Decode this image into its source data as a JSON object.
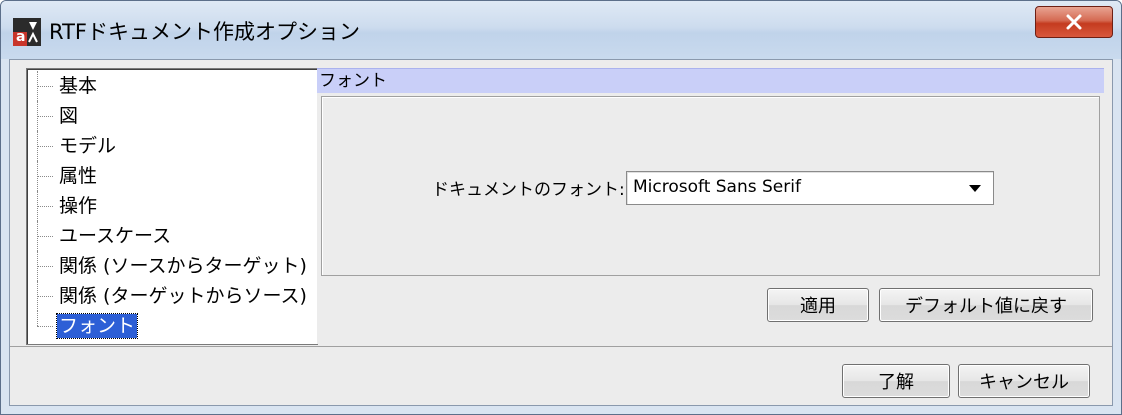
{
  "window": {
    "title": "RTFドキュメント作成オプション",
    "app_icon": "astah-icon",
    "close_icon": "close-icon"
  },
  "tree": {
    "items": [
      {
        "label": "基本",
        "selected": false
      },
      {
        "label": "図",
        "selected": false
      },
      {
        "label": "モデル",
        "selected": false
      },
      {
        "label": "属性",
        "selected": false
      },
      {
        "label": "操作",
        "selected": false
      },
      {
        "label": "ユースケース",
        "selected": false
      },
      {
        "label": "関係 (ソースからターゲット)",
        "selected": false
      },
      {
        "label": "関係 (ターゲットからソース)",
        "selected": false
      },
      {
        "label": "フォント",
        "selected": true
      }
    ]
  },
  "panel": {
    "header": "フォント",
    "font_label": "ドキュメントのフォント:",
    "font_value": "Microsoft Sans Serif",
    "apply_button": "適用",
    "default_button": "デフォルト値に戻す"
  },
  "footer": {
    "ok_button": "了解",
    "cancel_button": "キャンセル"
  },
  "colors": {
    "selection": "#2d5fd6",
    "section_header": "#c9cff8",
    "close_button": "#c43b1f"
  }
}
